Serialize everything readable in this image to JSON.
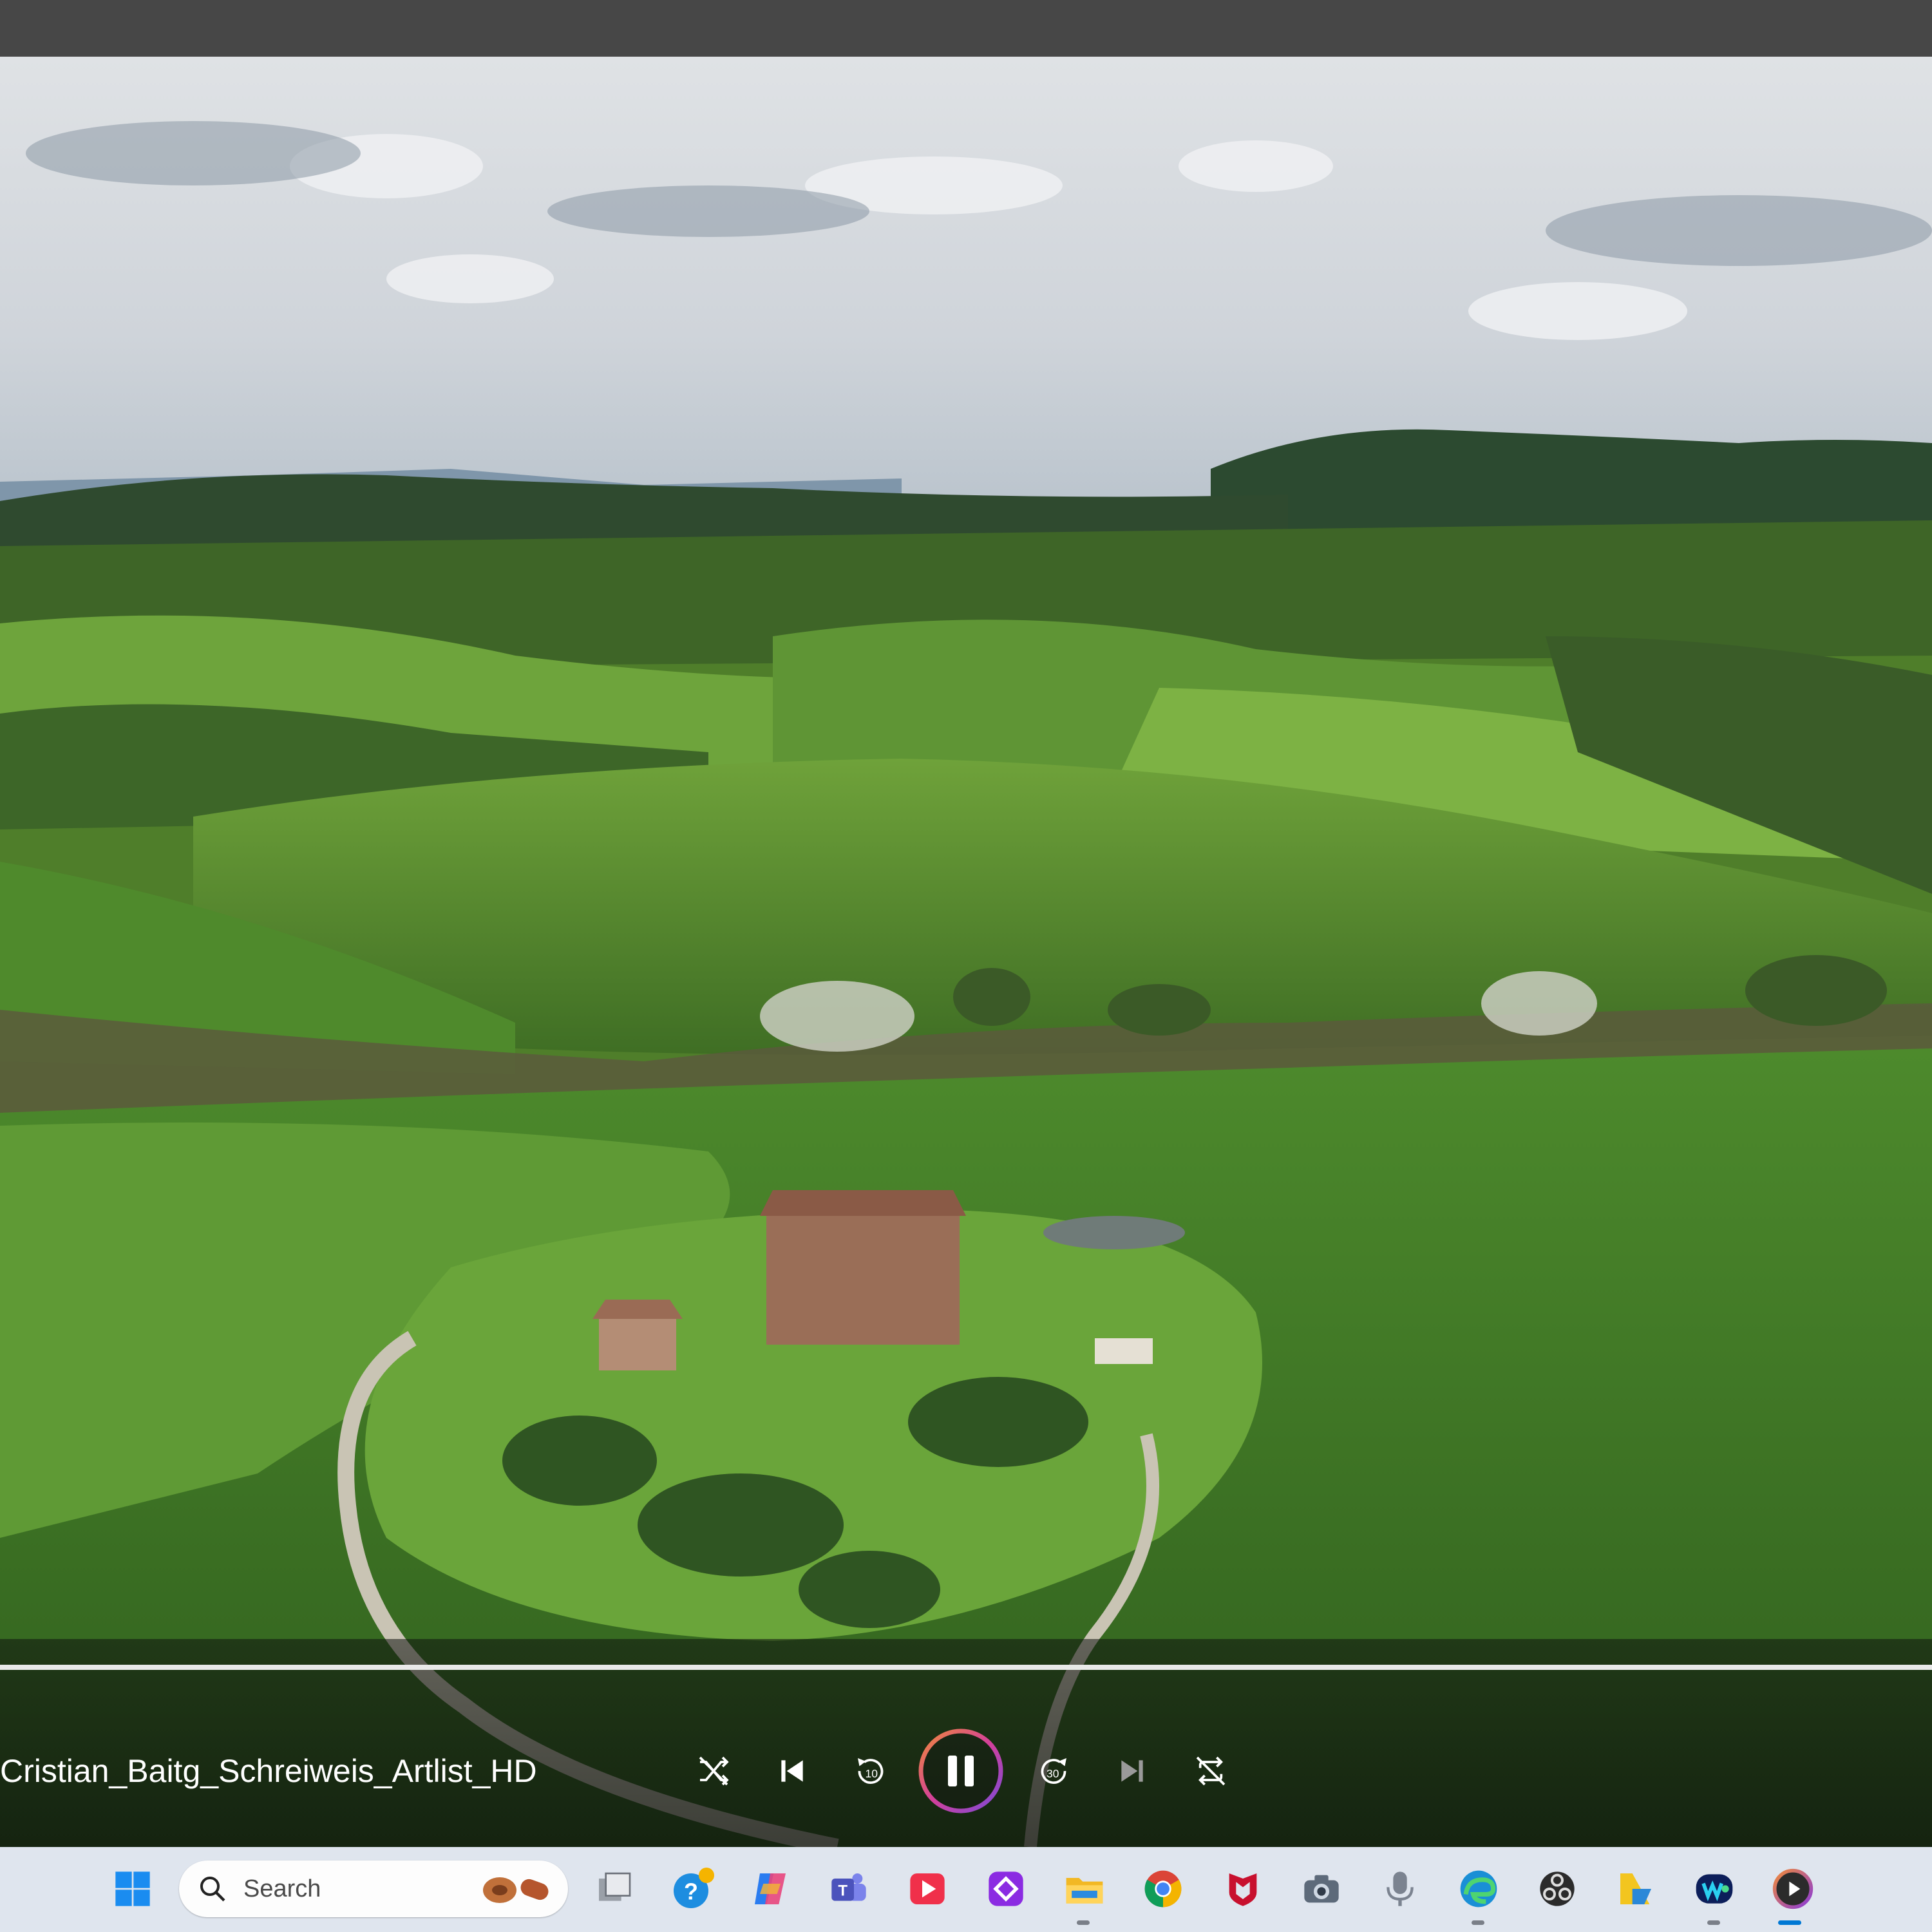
{
  "window": {
    "title": ""
  },
  "player": {
    "track_title": "Cristian_Baitg_Schreiweis_Artlist_HD",
    "progress": 1.0,
    "state": "playing",
    "controls": {
      "shuffle": "shuffle-icon",
      "previous": "skip-previous-icon",
      "rewind_label": "10",
      "play_pause": "pause-icon",
      "forward_label": "30",
      "next": "skip-next-icon",
      "repeat": "repeat-off-icon"
    },
    "accent": "#d4409a"
  },
  "taskbar": {
    "search_placeholder": "Search",
    "apps": [
      "start-icon",
      "search-icon",
      "task-view-icon",
      "help-icon",
      "copilot-icon",
      "teams-icon",
      "media-app-icon",
      "app-icon",
      "file-explorer-icon",
      "chrome-icon",
      "mcafee-icon",
      "camera-icon",
      "microphone-icon",
      "edge-icon",
      "obs-icon",
      "folder-app-icon",
      "webex-icon",
      "media-player-icon"
    ],
    "colors": {
      "bar": "#dfe5ee",
      "active": "#0078d4"
    }
  }
}
